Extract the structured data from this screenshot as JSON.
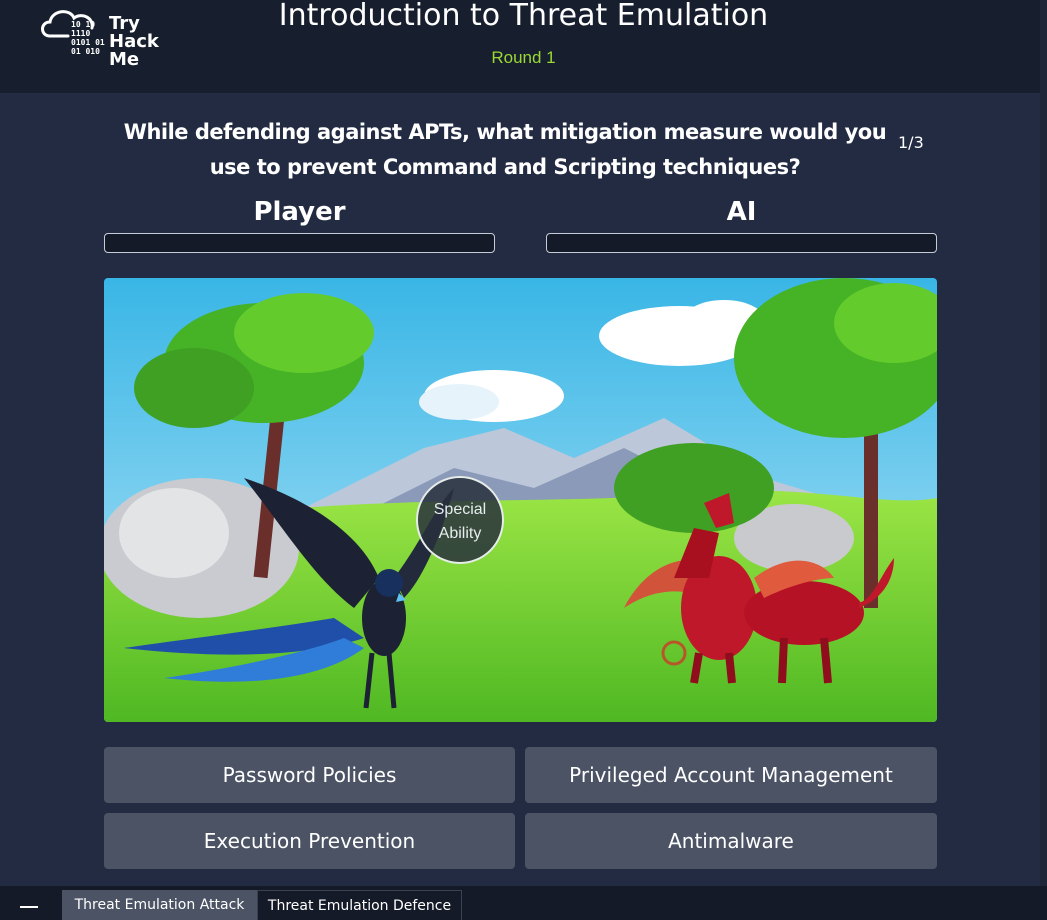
{
  "header": {
    "logo_words": [
      "Try",
      "Hack",
      "Me"
    ],
    "logo_bits": [
      "10  10",
      "1110",
      "0101 01",
      "01  010"
    ],
    "title": "Introduction to Threat Emulation",
    "round": "Round 1"
  },
  "question": {
    "text": "While defending against APTs, what mitigation measure would you use to prevent Command and Scripting techniques?",
    "counter": "1/3"
  },
  "players": {
    "player_label": "Player",
    "ai_label": "AI",
    "player_health": 0,
    "ai_health": 0
  },
  "scene": {
    "special_ability_line1": "Special",
    "special_ability_line2": "Ability",
    "player_character_icon": "dark-blue-phoenix",
    "ai_character_icon": "red-dragon"
  },
  "answers": [
    "Password Policies",
    "Privileged Account Management",
    "Execution Prevention",
    "Antimalware"
  ],
  "tabs": [
    "Threat Emulation Attack",
    "Threat Emulation Defence"
  ],
  "active_tab_index": 0,
  "colors": {
    "header_bg": "#171f2e",
    "page_bg": "#222b42",
    "accent_green": "#9bd836",
    "button_bg": "#4b5365"
  }
}
